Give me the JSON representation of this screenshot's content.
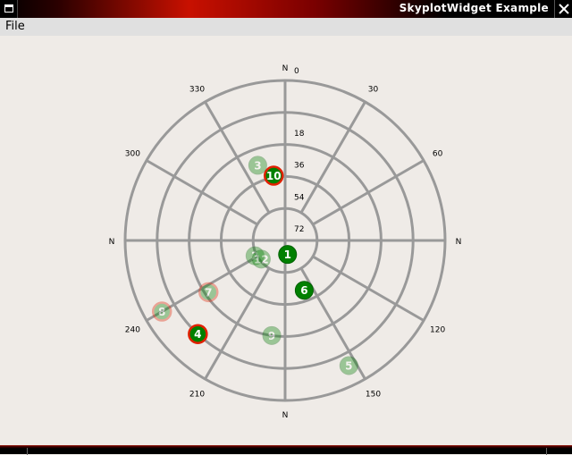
{
  "window": {
    "title": "SkyplotWidget Example"
  },
  "menu": {
    "file_label": "File"
  },
  "skyplot": {
    "grid_color": "#999999",
    "elevation_labels": [
      "0",
      "18",
      "36",
      "54",
      "72"
    ],
    "azimuth_labels": [
      {
        "az": 30,
        "text": "30"
      },
      {
        "az": 60,
        "text": "60"
      },
      {
        "az": 120,
        "text": "120"
      },
      {
        "az": 150,
        "text": "150"
      },
      {
        "az": 210,
        "text": "210"
      },
      {
        "az": 240,
        "text": "240"
      },
      {
        "az": 300,
        "text": "300"
      },
      {
        "az": 330,
        "text": "330"
      }
    ],
    "cardinal_labels": [
      "N",
      "N",
      "N",
      "N"
    ],
    "satellites": [
      {
        "id": "1",
        "az": 170,
        "el": 82,
        "active": true,
        "marked": false
      },
      {
        "id": "6",
        "az": 159,
        "el": 60,
        "active": true,
        "marked": false
      },
      {
        "id": "4",
        "az": 223,
        "el": 18,
        "active": true,
        "marked": true
      },
      {
        "id": "10",
        "az": 350,
        "el": 53,
        "active": true,
        "marked": true
      },
      {
        "id": "8",
        "az": 240,
        "el": 10,
        "active": false,
        "marked": true
      },
      {
        "id": "7",
        "az": 236,
        "el": 38,
        "active": false,
        "marked": true
      },
      {
        "id": "3",
        "az": 340,
        "el": 45,
        "active": false,
        "marked": false
      },
      {
        "id": "2",
        "az": 243,
        "el": 71,
        "active": false,
        "marked": false
      },
      {
        "id": "12",
        "az": 232,
        "el": 73,
        "active": false,
        "marked": false
      },
      {
        "id": "9",
        "az": 188,
        "el": 36,
        "active": false,
        "marked": false
      },
      {
        "id": "5",
        "az": 153,
        "el": 11,
        "active": false,
        "marked": false
      }
    ]
  }
}
